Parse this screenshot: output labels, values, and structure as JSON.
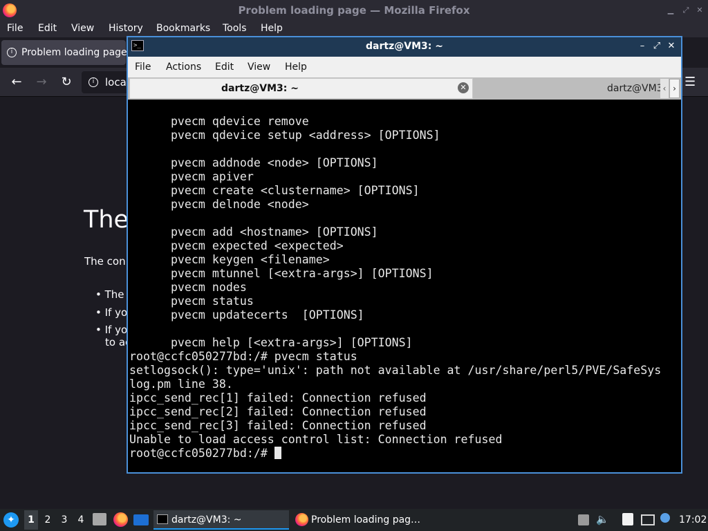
{
  "firefox": {
    "title": "Problem loading page — Mozilla Firefox",
    "menu": [
      "File",
      "Edit",
      "View",
      "History",
      "Bookmarks",
      "Tools",
      "Help"
    ],
    "tab_label": "Problem loading page",
    "url_text": "loca",
    "page": {
      "heading": "The",
      "description": "The con",
      "bullets": [
        "The",
        "If yo",
        "If yo",
        "to ac"
      ]
    }
  },
  "terminal": {
    "title": "dartz@VM3: ~",
    "menu": [
      "File",
      "Actions",
      "Edit",
      "View",
      "Help"
    ],
    "tabs": [
      "dartz@VM3: ~",
      "dartz@VM3"
    ],
    "lines": [
      "      pvecm qdevice remove",
      "      pvecm qdevice setup <address> [OPTIONS]",
      "",
      "      pvecm addnode <node> [OPTIONS]",
      "      pvecm apiver",
      "      pvecm create <clustername> [OPTIONS]",
      "      pvecm delnode <node>",
      "",
      "      pvecm add <hostname> [OPTIONS]",
      "      pvecm expected <expected>",
      "      pvecm keygen <filename>",
      "      pvecm mtunnel [<extra-args>] [OPTIONS]",
      "      pvecm nodes",
      "      pvecm status",
      "      pvecm updatecerts  [OPTIONS]",
      "",
      "      pvecm help [<extra-args>] [OPTIONS]",
      "root@ccfc050277bd:/# pvecm status",
      "setlogsock(): type='unix': path not available at /usr/share/perl5/PVE/SafeSys",
      "log.pm line 38.",
      "ipcc_send_rec[1] failed: Connection refused",
      "ipcc_send_rec[2] failed: Connection refused",
      "ipcc_send_rec[3] failed: Connection refused",
      "Unable to load access control list: Connection refused"
    ],
    "prompt": "root@ccfc050277bd:/# "
  },
  "taskbar": {
    "desktops": [
      "1",
      "2",
      "3",
      "4"
    ],
    "tasks": [
      {
        "label": "dartz@VM3: ~",
        "icon": "terminal-icon"
      },
      {
        "label": "Problem loading pag…",
        "icon": "firefox-icon"
      }
    ],
    "clock": "17:02"
  },
  "colors": {
    "terminal_border": "#4a90d9",
    "terminal_bg": "#000000",
    "firefox_bg": "#1c1b22",
    "taskbar_bg": "#202326"
  }
}
